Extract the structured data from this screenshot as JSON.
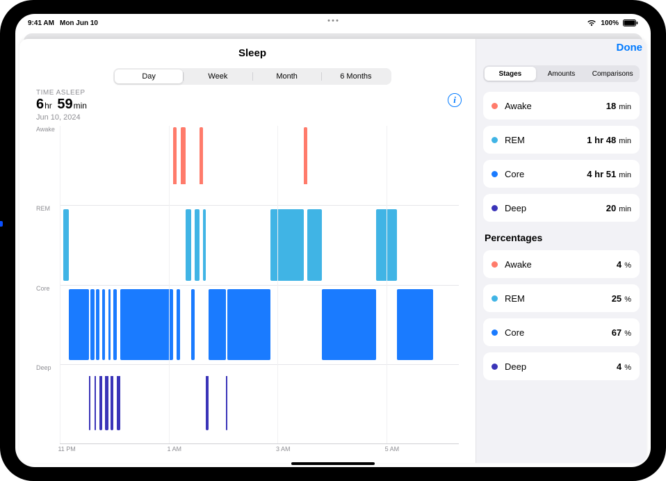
{
  "status": {
    "time": "9:41 AM",
    "date": "Mon Jun 10",
    "battery": "100%"
  },
  "header": {
    "title": "Sleep",
    "done": "Done"
  },
  "range_seg": {
    "items": [
      "Day",
      "Week",
      "Month",
      "6 Months"
    ],
    "selected": 0
  },
  "summary": {
    "label": "TIME ASLEEP",
    "hr": "6",
    "hr_u": "hr",
    "min": "59",
    "min_u": "min",
    "date": "Jun 10, 2024"
  },
  "side_seg": {
    "items": [
      "Stages",
      "Amounts",
      "Comparisons"
    ],
    "selected": 0
  },
  "stages_duration": [
    {
      "name": "Awake",
      "color": "#ff7b6b",
      "text": "18",
      "unit": "min",
      "prefix": ""
    },
    {
      "name": "REM",
      "color": "#40b4e5",
      "text": "48",
      "unit": "min",
      "prefix": "1 hr "
    },
    {
      "name": "Core",
      "color": "#1a7bff",
      "text": "51",
      "unit": "min",
      "prefix": "4 hr "
    },
    {
      "name": "Deep",
      "color": "#3a34b8",
      "text": "20",
      "unit": "min",
      "prefix": ""
    }
  ],
  "percent_title": "Percentages",
  "stages_percent": [
    {
      "name": "Awake",
      "color": "#ff7b6b",
      "text": "4",
      "unit": "%"
    },
    {
      "name": "REM",
      "color": "#40b4e5",
      "text": "25",
      "unit": "%"
    },
    {
      "name": "Core",
      "color": "#1a7bff",
      "text": "67",
      "unit": "%"
    },
    {
      "name": "Deep",
      "color": "#3a34b8",
      "text": "4",
      "unit": "%"
    }
  ],
  "chart_data": {
    "type": "sleep-stage-timeline",
    "title": "Sleep",
    "xlabel": "",
    "ylabel": "",
    "x_domain_minutes": [
      0,
      440
    ],
    "x_ticks": [
      {
        "label": "11 PM",
        "min": 0
      },
      {
        "label": "1 AM",
        "min": 120
      },
      {
        "label": "3 AM",
        "min": 240
      },
      {
        "label": "5 AM",
        "min": 360
      }
    ],
    "lanes": [
      "Awake",
      "REM",
      "Core",
      "Deep"
    ],
    "lane_colors": {
      "Awake": "#ff7b6b",
      "REM": "#40b4e5",
      "Core": "#1a7bff",
      "Deep": "#3a34b8"
    },
    "segments": [
      {
        "lane": "REM",
        "start": 4,
        "end": 10
      },
      {
        "lane": "Core",
        "start": 10,
        "end": 32
      },
      {
        "lane": "Deep",
        "start": 32,
        "end": 34
      },
      {
        "lane": "Core",
        "start": 34,
        "end": 38
      },
      {
        "lane": "Deep",
        "start": 38,
        "end": 40
      },
      {
        "lane": "Core",
        "start": 40,
        "end": 44
      },
      {
        "lane": "Deep",
        "start": 44,
        "end": 47
      },
      {
        "lane": "Core",
        "start": 47,
        "end": 50
      },
      {
        "lane": "Deep",
        "start": 50,
        "end": 54
      },
      {
        "lane": "Core",
        "start": 54,
        "end": 56
      },
      {
        "lane": "Deep",
        "start": 56,
        "end": 59
      },
      {
        "lane": "Core",
        "start": 59,
        "end": 63
      },
      {
        "lane": "Deep",
        "start": 63,
        "end": 67
      },
      {
        "lane": "Core",
        "start": 67,
        "end": 125
      },
      {
        "lane": "Awake",
        "start": 125,
        "end": 129
      },
      {
        "lane": "Core",
        "start": 129,
        "end": 133
      },
      {
        "lane": "Awake",
        "start": 133,
        "end": 139
      },
      {
        "lane": "REM",
        "start": 139,
        "end": 145
      },
      {
        "lane": "Core",
        "start": 145,
        "end": 149
      },
      {
        "lane": "REM",
        "start": 149,
        "end": 154
      },
      {
        "lane": "Awake",
        "start": 154,
        "end": 158
      },
      {
        "lane": "REM",
        "start": 158,
        "end": 161
      },
      {
        "lane": "Deep",
        "start": 161,
        "end": 164
      },
      {
        "lane": "Core",
        "start": 164,
        "end": 183
      },
      {
        "lane": "Deep",
        "start": 183,
        "end": 185
      },
      {
        "lane": "Core",
        "start": 185,
        "end": 232
      },
      {
        "lane": "REM",
        "start": 232,
        "end": 269
      },
      {
        "lane": "Awake",
        "start": 269,
        "end": 273
      },
      {
        "lane": "REM",
        "start": 273,
        "end": 289
      },
      {
        "lane": "Core",
        "start": 289,
        "end": 349
      },
      {
        "lane": "REM",
        "start": 349,
        "end": 372
      },
      {
        "lane": "Core",
        "start": 372,
        "end": 412
      }
    ]
  }
}
